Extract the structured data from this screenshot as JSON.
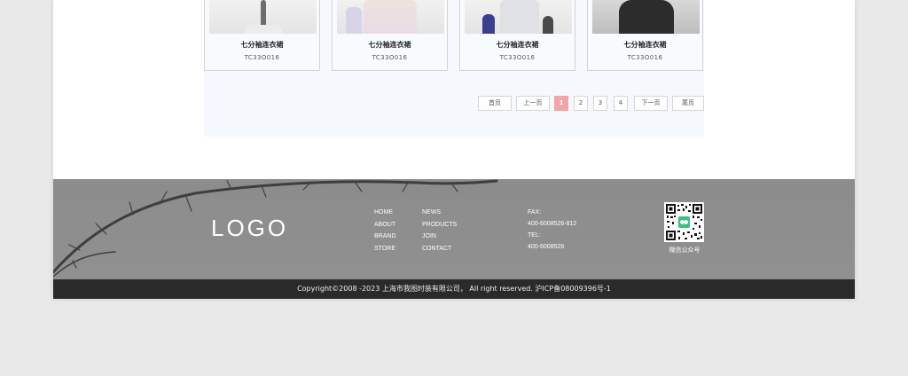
{
  "products": [
    {
      "name": "七分袖连衣裙",
      "code": "TC33O016"
    },
    {
      "name": "七分袖连衣裙",
      "code": "TC33O016"
    },
    {
      "name": "七分袖连衣裙",
      "code": "TC33O016"
    },
    {
      "name": "七分袖连衣裙",
      "code": "TC33O016"
    }
  ],
  "pagination": {
    "first": "首页",
    "prev": "上一页",
    "pages": [
      "1",
      "2",
      "3",
      "4"
    ],
    "current": "1",
    "next": "下一页",
    "last": "尾页"
  },
  "footer": {
    "logo": "LOGO",
    "nav_col1": [
      "HOME",
      "ABOUT",
      "BRAND",
      "STORE"
    ],
    "nav_col2": [
      "NEWS",
      "PRODUCTS",
      "JOIN",
      "CONTACT"
    ],
    "fax_label": "FAX:",
    "fax": "400-6008526-812",
    "tel_label": "TEL:",
    "tel": "400-6008526",
    "qr_label": "微信公众号",
    "copyright": "Copyright©2008 -2023 上海市我图时装有限公司， All right reserved.   沪ICP备08009396号-1"
  },
  "colors": {
    "accent": "#f2a4a4",
    "footer_bg": "#8e8e8e",
    "bottom_bar": "#2a2a2a"
  }
}
